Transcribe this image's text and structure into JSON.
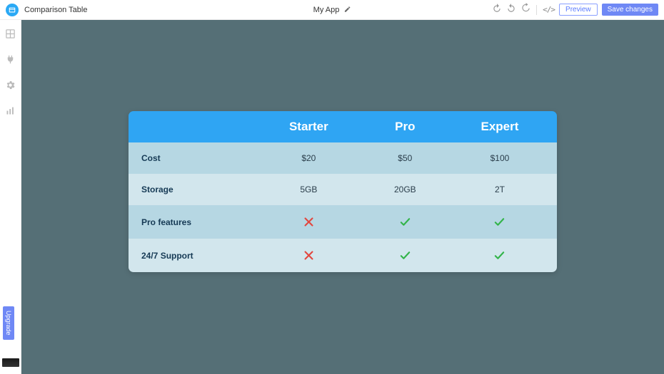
{
  "topbar": {
    "widget_title": "Comparison Table",
    "app_name": "My App",
    "preview_label": "Preview",
    "save_label": "Save changes"
  },
  "sidebar": {
    "upgrade_label": "Upgrade"
  },
  "table": {
    "headers": [
      "",
      "Starter",
      "Pro",
      "Expert"
    ],
    "rows": [
      {
        "label": "Cost",
        "cells": [
          {
            "type": "text",
            "value": "$20"
          },
          {
            "type": "text",
            "value": "$50"
          },
          {
            "type": "text",
            "value": "$100"
          }
        ]
      },
      {
        "label": "Storage",
        "cells": [
          {
            "type": "text",
            "value": "5GB"
          },
          {
            "type": "text",
            "value": "20GB"
          },
          {
            "type": "text",
            "value": "2T"
          }
        ]
      },
      {
        "label": "Pro features",
        "cells": [
          {
            "type": "cross"
          },
          {
            "type": "check"
          },
          {
            "type": "check"
          }
        ]
      },
      {
        "label": "24/7 Support",
        "cells": [
          {
            "type": "cross"
          },
          {
            "type": "check"
          },
          {
            "type": "check"
          }
        ]
      }
    ]
  },
  "colors": {
    "accent_blue": "#2fa5f3",
    "primary_button": "#6f88f5",
    "canvas_bg": "#556f76",
    "check_green": "#33b44a",
    "cross_red": "#e2473f"
  }
}
